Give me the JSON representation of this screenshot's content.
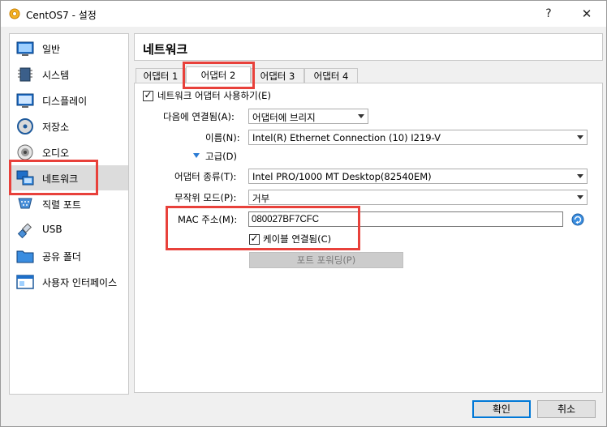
{
  "window": {
    "title": "CentOS7 - 설정",
    "help": "?",
    "close": "✕"
  },
  "sidebar": {
    "items": [
      {
        "label": "일반",
        "icon": "general-monitor-icon"
      },
      {
        "label": "시스템",
        "icon": "system-chip-icon"
      },
      {
        "label": "디스플레이",
        "icon": "display-monitor-icon"
      },
      {
        "label": "저장소",
        "icon": "storage-disk-icon"
      },
      {
        "label": "오디오",
        "icon": "audio-speaker-icon"
      },
      {
        "label": "네트워크",
        "icon": "network-icon",
        "selected": true
      },
      {
        "label": "직렬 포트",
        "icon": "serial-port-icon"
      },
      {
        "label": "USB",
        "icon": "usb-icon"
      },
      {
        "label": "공유 폴더",
        "icon": "shared-folder-icon"
      },
      {
        "label": "사용자 인터페이스",
        "icon": "user-interface-icon"
      }
    ]
  },
  "section": {
    "title": "네트워크"
  },
  "tabs": [
    "어댑터 1",
    "어댑터 2",
    "어댑터 3",
    "어댑터 4"
  ],
  "active_tab": "어댑터 2",
  "adapter": {
    "enable_label": "네트워크 어댑터 사용하기(E)",
    "enable_checked": true,
    "attached_label": "다음에 연결됨(A):",
    "attached_value": "어댑터에 브리지",
    "name_label": "이름(N):",
    "name_value": "Intel(R) Ethernet Connection (10) I219-V",
    "advanced_label": "고급(D)",
    "type_label": "어댑터 종류(T):",
    "type_value": "Intel PRO/1000 MT Desktop(82540EM)",
    "promisc_label": "무작위 모드(P):",
    "promisc_value": "거부",
    "mac_label": "MAC 주소(M):",
    "mac_value": "080027BF7CFC",
    "cable_label": "케이블 연결됨(C)",
    "cable_checked": true,
    "port_forward_label": "포트 포워딩(P)"
  },
  "buttons": {
    "ok": "확인",
    "cancel": "취소"
  },
  "colors": {
    "highlight": "#e8413b",
    "accent": "#0078d7",
    "selected_bg": "#dcdcdc"
  }
}
